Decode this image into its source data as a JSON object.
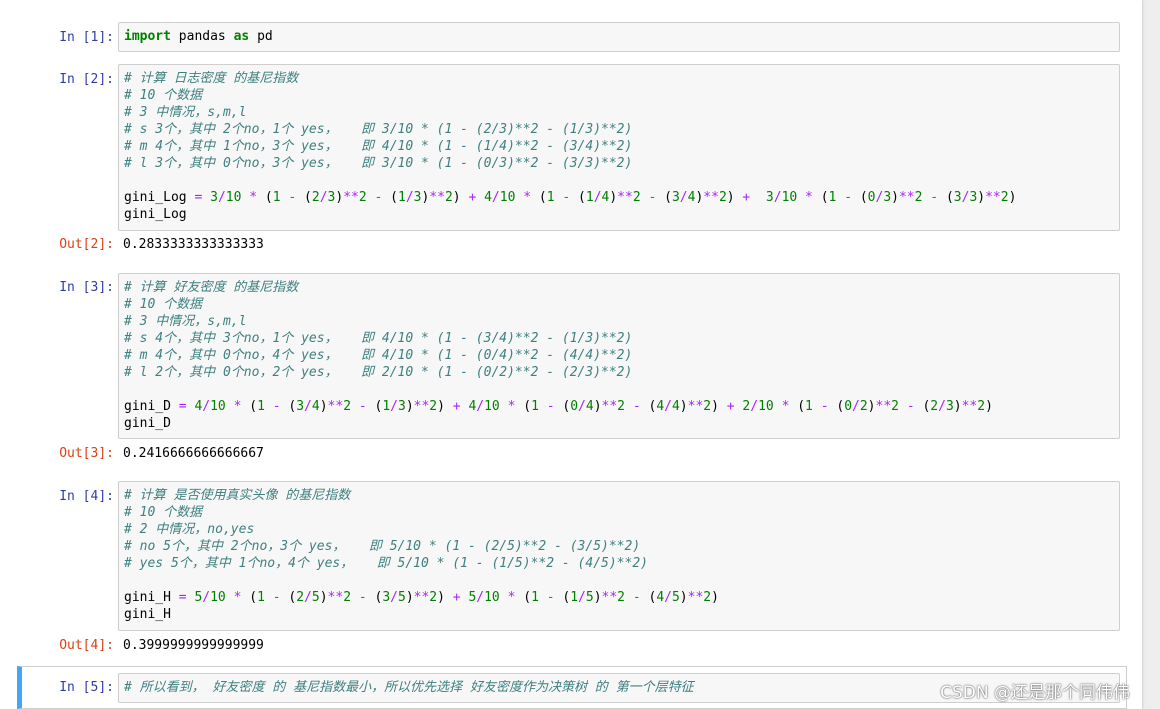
{
  "cells": [
    {
      "in_prompt": "In [1]:",
      "code_lines": [
        "import pandas as pd"
      ]
    },
    {
      "in_prompt": "In [2]:",
      "code_lines": [
        "# 计算 日志密度 的基尼指数",
        "# 10 个数据",
        "# 3 中情况，s,m,l",
        "# s 3个，其中 2个no，1个 yes，   即 3/10 * (1 - (2/3)**2 - (1/3)**2)",
        "# m 4个，其中 1个no，3个 yes，   即 4/10 * (1 - (1/4)**2 - (3/4)**2)",
        "# l 3个，其中 0个no，3个 yes，   即 3/10 * (1 - (0/3)**2 - (3/3)**2)",
        "",
        "gini_Log = 3/10 * (1 - (2/3)**2 - (1/3)**2) + 4/10 * (1 - (1/4)**2 - (3/4)**2) +  3/10 * (1 - (0/3)**2 - (3/3)**2)",
        "gini_Log"
      ],
      "out_prompt": "Out[2]:",
      "output": "0.2833333333333333"
    },
    {
      "in_prompt": "In [3]:",
      "code_lines": [
        "# 计算 好友密度 的基尼指数",
        "# 10 个数据",
        "# 3 中情况，s,m,l",
        "# s 4个，其中 3个no，1个 yes，   即 4/10 * (1 - (3/4)**2 - (1/3)**2)",
        "# m 4个，其中 0个no，4个 yes，   即 4/10 * (1 - (0/4)**2 - (4/4)**2)",
        "# l 2个，其中 0个no，2个 yes，   即 2/10 * (1 - (0/2)**2 - (2/3)**2)",
        "",
        "gini_D = 4/10 * (1 - (3/4)**2 - (1/3)**2) + 4/10 * (1 - (0/4)**2 - (4/4)**2) + 2/10 * (1 - (0/2)**2 - (2/3)**2)",
        "gini_D"
      ],
      "out_prompt": "Out[3]:",
      "output": "0.2416666666666667"
    },
    {
      "in_prompt": "In [4]:",
      "code_lines": [
        "# 计算 是否使用真实头像 的基尼指数",
        "# 10 个数据",
        "# 2 中情况，no,yes",
        "# no 5个，其中 2个no，3个 yes，   即 5/10 * (1 - (2/5)**2 - (3/5)**2)",
        "# yes 5个，其中 1个no，4个 yes，   即 5/10 * (1 - (1/5)**2 - (4/5)**2)",
        "",
        "gini_H = 5/10 * (1 - (2/5)**2 - (3/5)**2) + 5/10 * (1 - (1/5)**2 - (4/5)**2)",
        "gini_H"
      ],
      "out_prompt": "Out[4]:",
      "output": "0.3999999999999999"
    },
    {
      "in_prompt": "In [5]:",
      "code_lines": [
        "# 所以看到， 好友密度 的 基尼指数最小，所以优先选择 好友密度作为决策树 的 第一个层特征"
      ]
    }
  ],
  "watermark": "CSDN @还是那个同伟伟",
  "colors": {
    "comment": "#408080",
    "keyword": "#008000",
    "number": "#008000",
    "operator": "#aa22ff",
    "in_prompt": "#303f9f",
    "out_prompt": "#d84315",
    "selected_border": "#42a5f5"
  }
}
